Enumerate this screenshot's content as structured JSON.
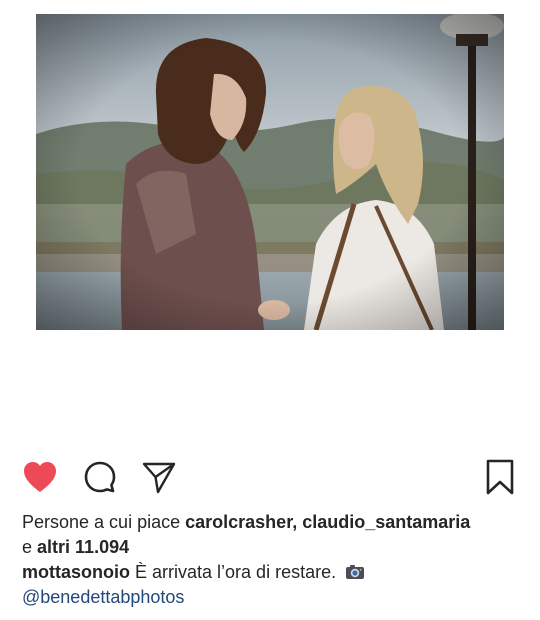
{
  "post": {
    "image_alt": "Photo of a man with long curly hair and a blonde woman facing each other by a lake",
    "likes": {
      "prefix": "Persone a cui piace",
      "user1": "carolcrasher",
      "separator": ",",
      "user2": "claudio_santamaria",
      "conjunction": "e",
      "others": "altri 11.094"
    },
    "caption": {
      "username": "mottasonoio",
      "text": "È arrivata l’ora di restare.",
      "mention": "@benedettabphotos"
    },
    "liked": true
  },
  "icons": {
    "like": "heart-icon",
    "comment": "comment-bubble-icon",
    "share": "send-paper-plane-icon",
    "save": "bookmark-icon",
    "caption_emoji": "camera-icon"
  },
  "colors": {
    "like_red": "#ed4956",
    "text": "#262626",
    "mention_blue": "#23487a"
  }
}
